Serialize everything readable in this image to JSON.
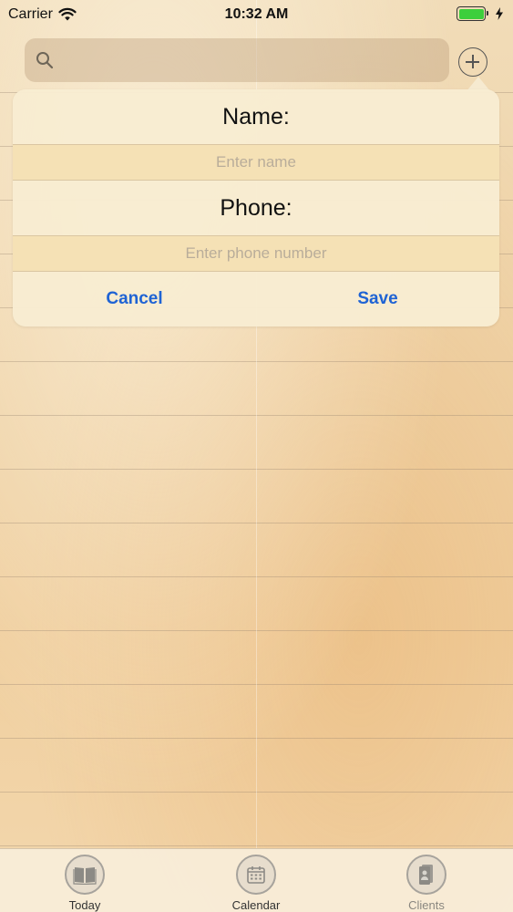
{
  "status_bar": {
    "carrier": "Carrier",
    "time": "10:32 AM"
  },
  "search": {
    "placeholder": ""
  },
  "popover": {
    "name_label": "Name:",
    "name_placeholder": "Enter name",
    "phone_label": "Phone:",
    "phone_placeholder": "Enter phone number",
    "cancel_label": "Cancel",
    "save_label": "Save"
  },
  "tabs": [
    {
      "label": "Today",
      "icon": "book-icon"
    },
    {
      "label": "Calendar",
      "icon": "calendar-icon"
    },
    {
      "label": "Clients",
      "icon": "contacts-icon"
    }
  ],
  "colors": {
    "accent": "#1f63d4",
    "battery": "#3ccf3c",
    "input_background": "#f5e1b5"
  }
}
